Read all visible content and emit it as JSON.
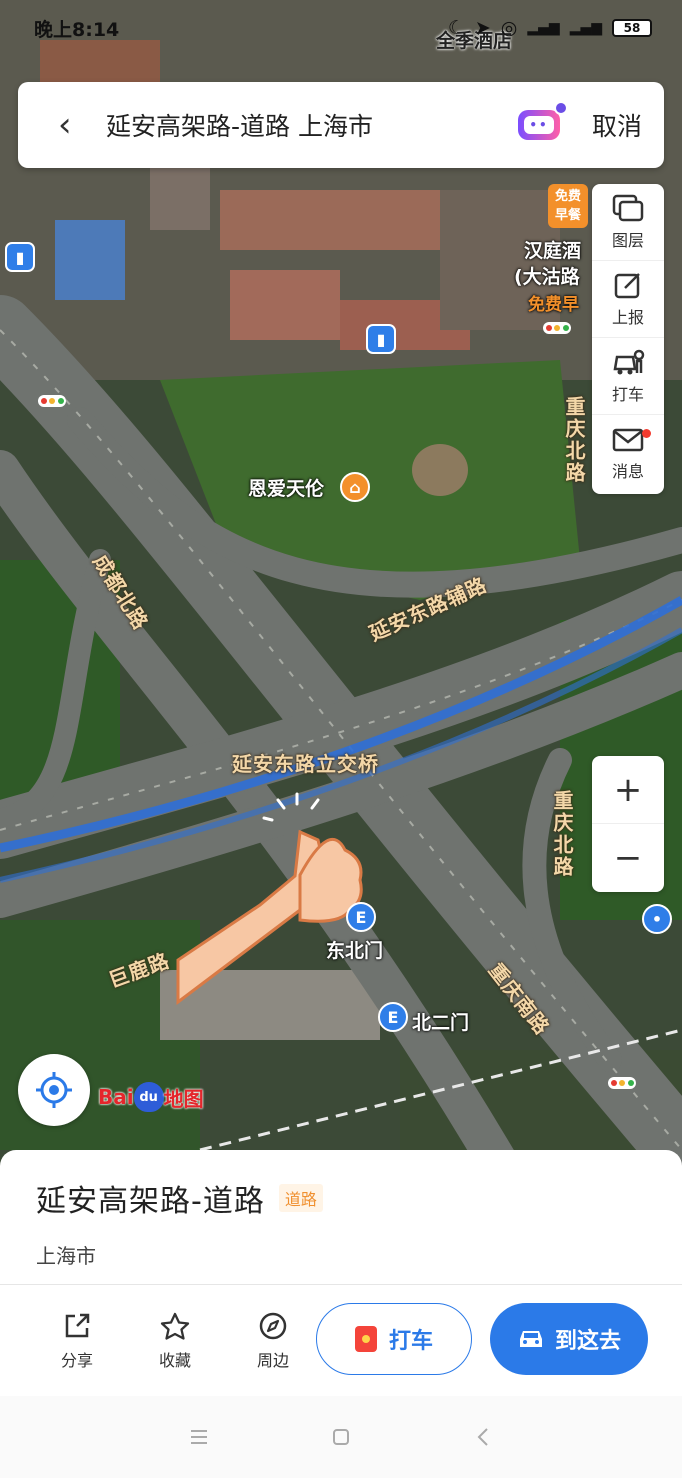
{
  "status_bar": {
    "time": "晚上8:14",
    "battery": "58"
  },
  "search": {
    "query": "延安高架路-道路 上海市",
    "cancel_label": "取消"
  },
  "toolbar": {
    "layers_label": "图层",
    "report_label": "上报",
    "taxi_label": "打车",
    "messages_label": "消息"
  },
  "map": {
    "pois": {
      "hotel_top": "全季酒店",
      "hotel_right_1": "汉庭酒",
      "hotel_right_2": "(大沽路",
      "hotel_right_free": "免费早",
      "free_breakfast_badge_1": "免费",
      "free_breakfast_badge_2": "早餐",
      "museum": "恩爱天伦",
      "gate_northeast": "东北门",
      "gate_north2": "北二门"
    },
    "roads": {
      "chengdu_north": "成都北路",
      "yanan_east_aux": "延安东路辅路",
      "interchange": "延安东路立交桥",
      "chongqing_north_top": "重庆北路",
      "chongqing_north_mid": "重庆北路",
      "chongqing_south": "重庆南路",
      "julu": "巨鹿路"
    },
    "logo_text": "Bai",
    "logo_paw": "du",
    "logo_suffix": "地图"
  },
  "zoom": {
    "in_label": "+",
    "out_label": "−"
  },
  "place": {
    "name": "延安高架路-道路",
    "tag": "道路",
    "city": "上海市"
  },
  "actions": {
    "share_label": "分享",
    "favorite_label": "收藏",
    "nearby_label": "周边",
    "taxi_label": "打车",
    "go_label": "到这去"
  },
  "colors": {
    "accent": "#2b7ae8",
    "highlight_road": "#2f6fd6",
    "poi_orange": "#f3902b"
  }
}
